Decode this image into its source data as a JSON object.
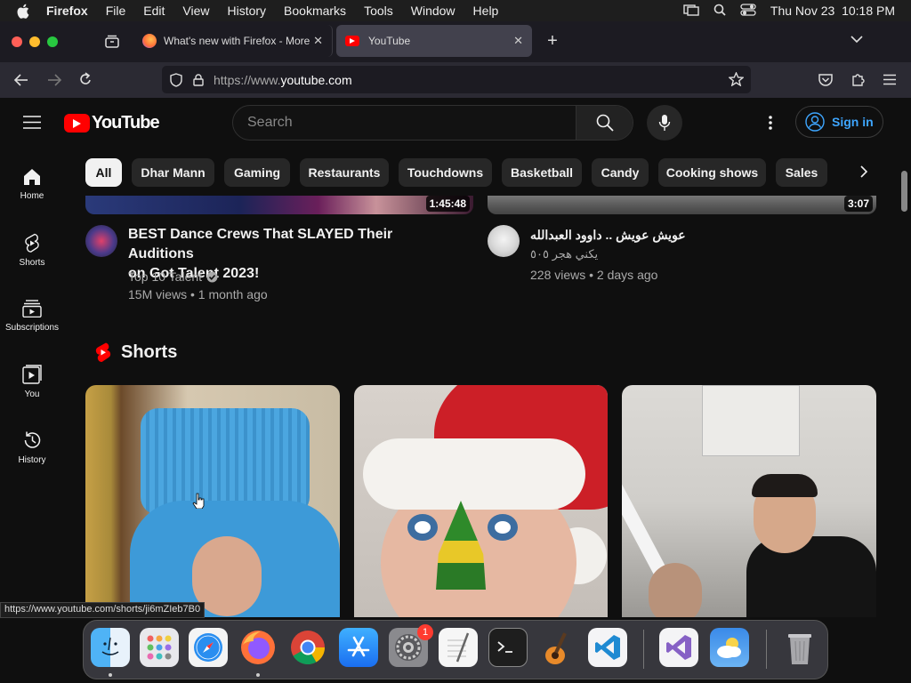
{
  "menubar": {
    "app": "Firefox",
    "items": [
      "File",
      "Edit",
      "View",
      "History",
      "Bookmarks",
      "Tools",
      "Window",
      "Help"
    ],
    "clock": "Thu Nov 23  10:18 PM"
  },
  "tabs": [
    {
      "title": "What's new with Firefox - More",
      "active": false
    },
    {
      "title": "YouTube",
      "active": true
    }
  ],
  "address": {
    "prefix": "https://www.",
    "domain": "youtube.com"
  },
  "youtube": {
    "logo": "YouTube",
    "search_placeholder": "Search",
    "sign_in": "Sign in",
    "sidebar": [
      {
        "label": "Home",
        "icon": "home-icon"
      },
      {
        "label": "Shorts",
        "icon": "shorts-icon"
      },
      {
        "label": "Subscriptions",
        "icon": "subscriptions-icon"
      },
      {
        "label": "You",
        "icon": "you-icon"
      },
      {
        "label": "History",
        "icon": "history-icon"
      }
    ],
    "chips": [
      "All",
      "Dhar Mann",
      "Gaming",
      "Restaurants",
      "Touchdowns",
      "Basketball",
      "Candy",
      "Cooking shows",
      "Sales"
    ],
    "videos": [
      {
        "duration": "1:45:48",
        "title_line1": "BEST Dance Crews That SLAYED Their Auditions",
        "title_line2": "on Got Talent 2023!",
        "channel": "Top 10 Talent",
        "stats": "15M views • 1 month ago"
      },
      {
        "duration": "3:07",
        "title_line1": "عويش عويش .. داوود العبدالله",
        "channel": "يكني هجر ٥٠٥",
        "stats": "228 views • 2 days ago"
      }
    ],
    "shorts_heading": "Shorts"
  },
  "status_url": "https://www.youtube.com/shorts/ji6mZIeb7B0",
  "dock": {
    "badge": "1"
  },
  "colors": {
    "yt_red": "#ff0000",
    "accent_blue": "#3ea6ff"
  }
}
